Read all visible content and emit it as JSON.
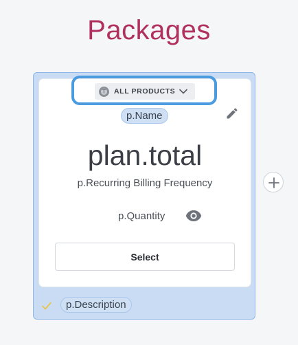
{
  "page": {
    "title": "Packages"
  },
  "package_card": {
    "product_selector": {
      "label": "ALL PRODUCTS",
      "badge_icon": "product-logo-icon"
    },
    "name_tag": "p.Name",
    "price": "plan.total",
    "frequency": "p.Recurring Billing Frequency",
    "quantity": "p.Quantity",
    "select_label": "Select",
    "description_tag": "p.Description"
  },
  "icons": {
    "edit": "pencil-icon",
    "visibility": "eye-icon",
    "check": "check-icon",
    "add": "plus-icon",
    "dropdown": "chevron-down-icon"
  },
  "colors": {
    "title": "#b03060",
    "card_frame": "#c9dcf3",
    "highlight": "#4a9be0",
    "check": "#e8c64a"
  }
}
